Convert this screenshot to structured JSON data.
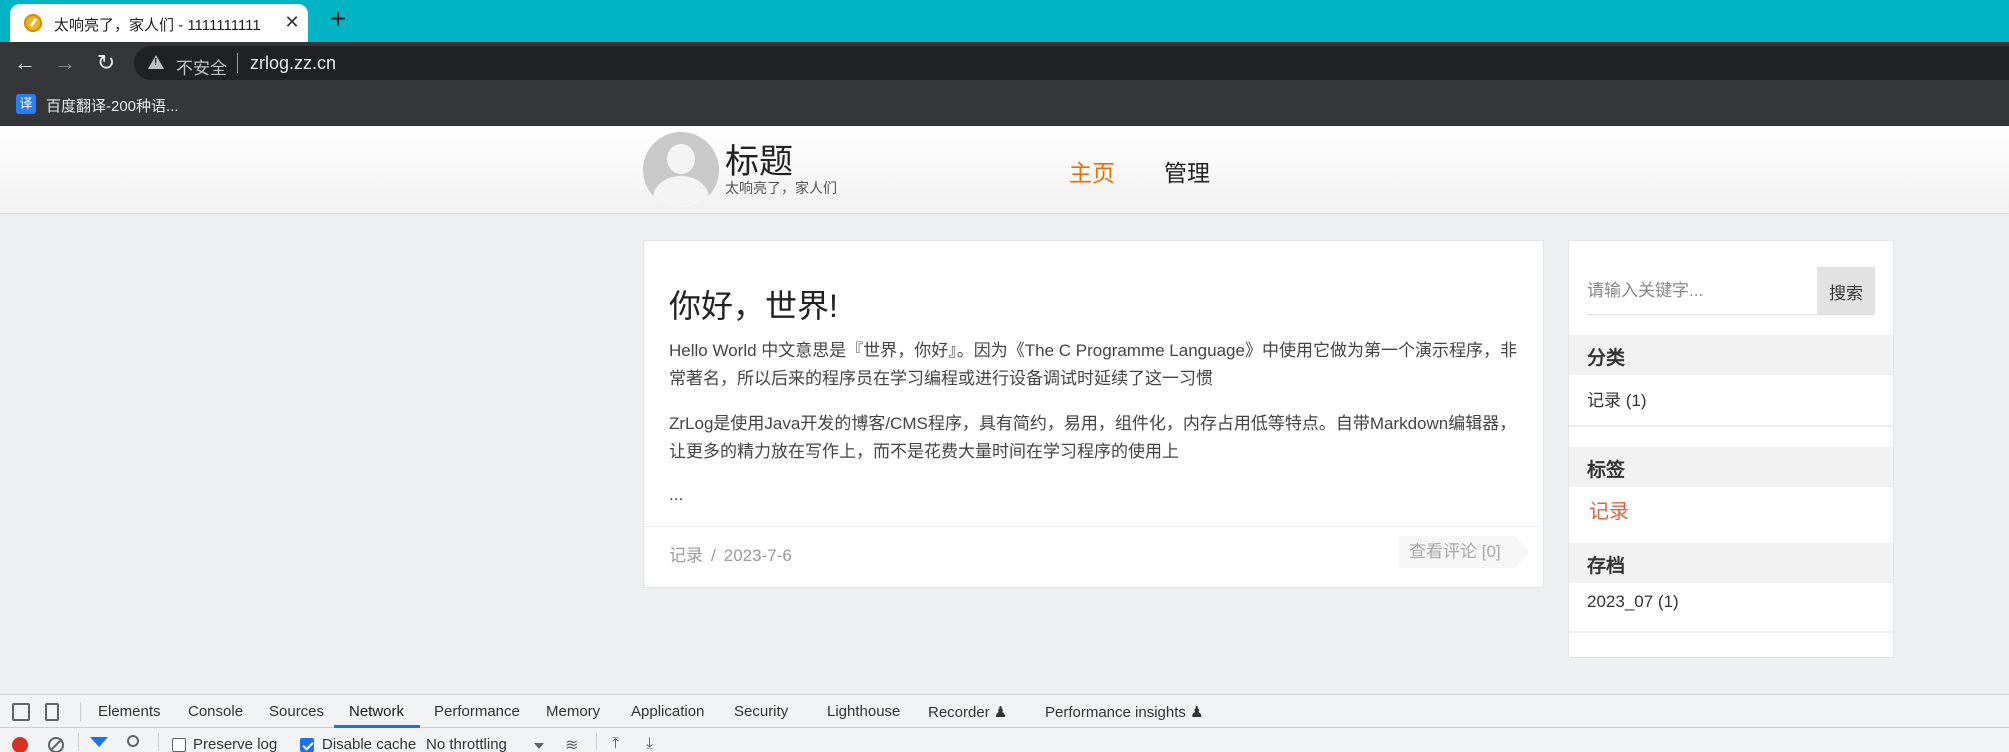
{
  "browser": {
    "tab_title": "太响亮了，家人们 - 1111111111",
    "url": "zrlog.zz.cn",
    "security_label": "不安全",
    "bookmark": "百度翻译-200种语...",
    "bookmark_icon_char": "译"
  },
  "site": {
    "title": "标题",
    "subtitle": "太响亮了，家人们",
    "nav": {
      "home": "主页",
      "admin": "管理"
    }
  },
  "post": {
    "title": "你好，世界!",
    "paragraph1": "Hello World 中文意思是『世界，你好』。因为《The C Programme Language》中使用它做为第一个演示程序，非常著名，所以后来的程序员在学习编程或进行设备调试时延续了这一习惯",
    "paragraph2": "ZrLog是使用Java开发的博客/CMS程序，具有简约，易用，组件化，内存占用低等特点。自带Markdown编辑器，让更多的精力放在写作上，而不是花费大量时间在学习程序的使用上",
    "more": "...",
    "category": "记录",
    "separator": "/",
    "date": "2023-7-6",
    "comments": "查看评论 [0]"
  },
  "sidebar": {
    "search_placeholder": "请输入关键字...",
    "search_button": "搜索",
    "categories_heading": "分类",
    "category_item": "记录 (1)",
    "tags_heading": "标签",
    "tag_item": "记录",
    "archive_heading": "存档",
    "archive_item": "2023_07 (1)"
  },
  "devtools": {
    "tabs": [
      "Elements",
      "Console",
      "Sources",
      "Network",
      "Performance",
      "Memory",
      "Application",
      "Security",
      "Lighthouse",
      "Recorder ♟",
      "Performance insights ♟"
    ],
    "active_tab": "Network",
    "preserve_log": "Preserve log",
    "disable_cache": "Disable cache",
    "throttling": "No throttling",
    "preserve_log_checked": false,
    "disable_cache_checked": true
  }
}
